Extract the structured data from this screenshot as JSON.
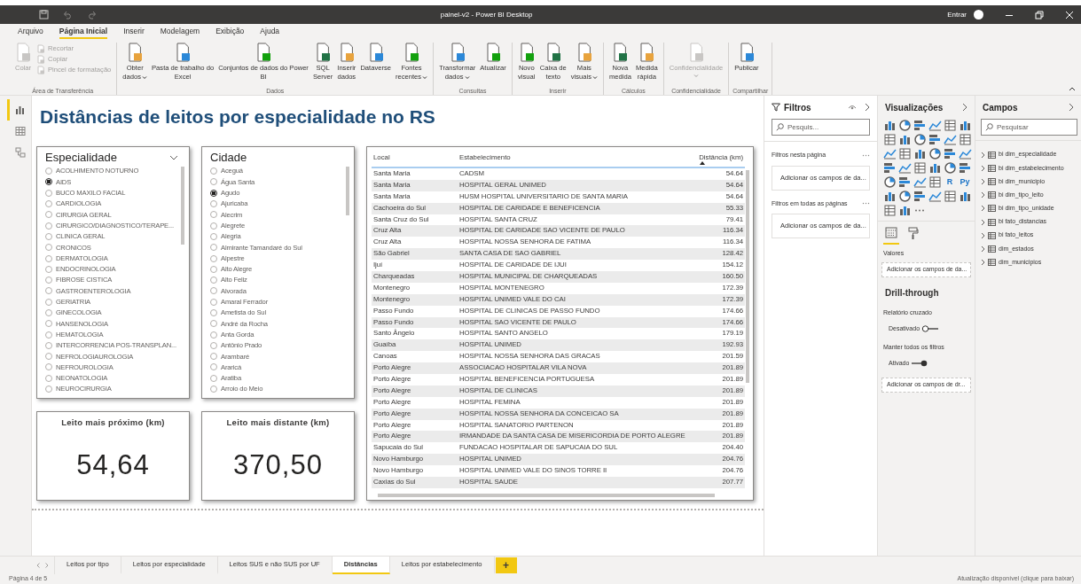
{
  "window": {
    "title": "painel-v2 - Power BI Desktop",
    "sign_in": "Entrar"
  },
  "ribbon": {
    "tabs": [
      {
        "label": "Arquivo",
        "selected": false
      },
      {
        "label": "Página Inicial",
        "selected": true
      },
      {
        "label": "Inserir",
        "selected": false
      },
      {
        "label": "Modelagem",
        "selected": false
      },
      {
        "label": "Exibição",
        "selected": false
      },
      {
        "label": "Ajuda",
        "selected": false
      }
    ],
    "groups": [
      {
        "label": "Área de Transferência",
        "commands": [
          {
            "label": "Colar",
            "kind": "large",
            "disabled": true,
            "dropdown": false
          },
          {
            "label": "Recortar",
            "kind": "small",
            "disabled": true,
            "dropdown": false
          },
          {
            "label": "Copiar",
            "kind": "small",
            "disabled": true,
            "dropdown": false
          },
          {
            "label": "Pincel de formatação",
            "kind": "small",
            "disabled": true,
            "dropdown": false
          }
        ]
      },
      {
        "label": "Dados",
        "commands": [
          {
            "label": "Obter\ndados",
            "kind": "large",
            "disabled": false,
            "dropdown": true
          },
          {
            "label": "Pasta de trabalho do\nExcel",
            "kind": "large",
            "disabled": false,
            "dropdown": false
          },
          {
            "label": "Conjuntos de dados do Power\nBI",
            "kind": "large",
            "disabled": false,
            "dropdown": false
          },
          {
            "label": "SQL\nServer",
            "kind": "large",
            "disabled": false,
            "dropdown": false
          },
          {
            "label": "Inserir\ndados",
            "kind": "large",
            "disabled": false,
            "dropdown": false
          },
          {
            "label": "Dataverse",
            "kind": "large",
            "disabled": false,
            "dropdown": false
          },
          {
            "label": "Fontes\nrecentes",
            "kind": "large",
            "disabled": false,
            "dropdown": true
          }
        ]
      },
      {
        "label": "Consultas",
        "commands": [
          {
            "label": "Transformar\ndados",
            "kind": "large",
            "disabled": false,
            "dropdown": true
          },
          {
            "label": "Atualizar",
            "kind": "large",
            "disabled": false,
            "dropdown": false
          }
        ]
      },
      {
        "label": "Inserir",
        "commands": [
          {
            "label": "Novo\nvisual",
            "kind": "large",
            "disabled": false,
            "dropdown": false
          },
          {
            "label": "Caixa de\ntexto",
            "kind": "large",
            "disabled": false,
            "dropdown": false
          },
          {
            "label": "Mais\nvisuais",
            "kind": "large",
            "disabled": false,
            "dropdown": true
          }
        ]
      },
      {
        "label": "Cálculos",
        "commands": [
          {
            "label": "Nova\nmedida",
            "kind": "large",
            "disabled": false,
            "dropdown": false
          },
          {
            "label": "Medida\nrápida",
            "kind": "large",
            "disabled": false,
            "dropdown": false
          }
        ]
      },
      {
        "label": "Confidencialidade",
        "commands": [
          {
            "label": "Confidencialidade",
            "kind": "large",
            "disabled": true,
            "dropdown": true
          }
        ]
      },
      {
        "label": "Compartilhar",
        "commands": [
          {
            "label": "Publicar",
            "kind": "large",
            "disabled": false,
            "dropdown": false
          }
        ]
      }
    ]
  },
  "view_rail": {
    "views": [
      {
        "kind": "report",
        "selected": true
      },
      {
        "kind": "data",
        "selected": false
      },
      {
        "kind": "model",
        "selected": false
      }
    ]
  },
  "report": {
    "title": "Distâncias de leitos por especialidade no RS",
    "slicers": [
      {
        "title": "Especialidade",
        "dropdown": true,
        "items": [
          {
            "label": "ACOLHIMENTO NOTURNO",
            "selected": false
          },
          {
            "label": "AIDS",
            "selected": true
          },
          {
            "label": "BUCO MAXILO FACIAL",
            "selected": false
          },
          {
            "label": "CARDIOLOGIA",
            "selected": false
          },
          {
            "label": "CIRURGIA GERAL",
            "selected": false
          },
          {
            "label": "CIRURGICO/DIAGNOSTICO/TERAPE...",
            "selected": false
          },
          {
            "label": "CLINICA GERAL",
            "selected": false
          },
          {
            "label": "CRONICOS",
            "selected": false
          },
          {
            "label": "DERMATOLOGIA",
            "selected": false
          },
          {
            "label": "ENDOCRINOLOGIA",
            "selected": false
          },
          {
            "label": "FIBROSE CISTICA",
            "selected": false
          },
          {
            "label": "GASTROENTEROLOGIA",
            "selected": false
          },
          {
            "label": "GERIATRIA",
            "selected": false
          },
          {
            "label": "GINECOLOGIA",
            "selected": false
          },
          {
            "label": "HANSENOLOGIA",
            "selected": false
          },
          {
            "label": "HEMATOLOGIA",
            "selected": false
          },
          {
            "label": "INTERCORRENCIA POS-TRANSPLAN...",
            "selected": false
          },
          {
            "label": "NEFROLOGIAUROLOGIA",
            "selected": false
          },
          {
            "label": "NEFROUROLOGIA",
            "selected": false
          },
          {
            "label": "NEONATOLOGIA",
            "selected": false
          },
          {
            "label": "NEUROCIRURGIA",
            "selected": false
          }
        ]
      },
      {
        "title": "Cidade",
        "dropdown": false,
        "items": [
          {
            "label": "Aceguá",
            "selected": false
          },
          {
            "label": "Água Santa",
            "selected": false
          },
          {
            "label": "Agudo",
            "selected": true
          },
          {
            "label": "Ajuricaba",
            "selected": false
          },
          {
            "label": "Alecrim",
            "selected": false
          },
          {
            "label": "Alegrete",
            "selected": false
          },
          {
            "label": "Alegria",
            "selected": false
          },
          {
            "label": "Almirante Tamandaré do Sul",
            "selected": false
          },
          {
            "label": "Alpestre",
            "selected": false
          },
          {
            "label": "Alto Alegre",
            "selected": false
          },
          {
            "label": "Alto Feliz",
            "selected": false
          },
          {
            "label": "Alvorada",
            "selected": false
          },
          {
            "label": "Amaral Ferrador",
            "selected": false
          },
          {
            "label": "Ametista do Sul",
            "selected": false
          },
          {
            "label": "André da Rocha",
            "selected": false
          },
          {
            "label": "Anta Gorda",
            "selected": false
          },
          {
            "label": "Antônio Prado",
            "selected": false
          },
          {
            "label": "Arambaré",
            "selected": false
          },
          {
            "label": "Araricá",
            "selected": false
          },
          {
            "label": "Aratiba",
            "selected": false
          },
          {
            "label": "Arroio do Meio",
            "selected": false
          }
        ]
      }
    ],
    "cards": [
      {
        "title": "Leito mais próximo (km)",
        "value": "54,64"
      },
      {
        "title": "Leito mais distante (km)",
        "value": "370,50"
      }
    ],
    "table": {
      "columns": [
        {
          "label": "Local",
          "sorted": false
        },
        {
          "label": "Estabelecimento",
          "sorted": false
        },
        {
          "label": "Distância (km)",
          "sorted": true
        }
      ],
      "rows": [
        [
          "Santa Maria",
          "CADSM",
          "54.64"
        ],
        [
          "Santa Maria",
          "HOSPITAL GERAL UNIMED",
          "54.64"
        ],
        [
          "Santa Maria",
          "HUSM HOSPITAL UNIVERSITARIO DE SANTA MARIA",
          "54.64"
        ],
        [
          "Cachoeira do Sul",
          "HOSPITAL DE CARIDADE E BENEFICENCIA",
          "55.33"
        ],
        [
          "Santa Cruz do Sul",
          "HOSPITAL SANTA CRUZ",
          "79.41"
        ],
        [
          "Cruz Alta",
          "HOSPITAL DE CARIDADE SAO VICENTE DE PAULO",
          "116.34"
        ],
        [
          "Cruz Alta",
          "HOSPITAL NOSSA SENHORA DE FATIMA",
          "116.34"
        ],
        [
          "São Gabriel",
          "SANTA CASA DE SAO GABRIEL",
          "128.42"
        ],
        [
          "Ijuí",
          "HOSPITAL DE CARIDADE DE IJUI",
          "154.12"
        ],
        [
          "Charqueadas",
          "HOSPITAL MUNICIPAL DE CHARQUEADAS",
          "160.50"
        ],
        [
          "Montenegro",
          "HOSPITAL MONTENEGRO",
          "172.39"
        ],
        [
          "Montenegro",
          "HOSPITAL UNIMED VALE DO CAI",
          "172.39"
        ],
        [
          "Passo Fundo",
          "HOSPITAL DE CLINICAS DE PASSO FUNDO",
          "174.66"
        ],
        [
          "Passo Fundo",
          "HOSPITAL SAO VICENTE DE PAULO",
          "174.66"
        ],
        [
          "Santo Ângelo",
          "HOSPITAL SANTO ANGELO",
          "179.19"
        ],
        [
          "Guaíba",
          "HOSPITAL UNIMED",
          "192.93"
        ],
        [
          "Canoas",
          "HOSPITAL NOSSA SENHORA DAS GRACAS",
          "201.59"
        ],
        [
          "Porto Alegre",
          "ASSOCIACAO HOSPITALAR VILA NOVA",
          "201.89"
        ],
        [
          "Porto Alegre",
          "HOSPITAL BENEFICENCIA PORTUGUESA",
          "201.89"
        ],
        [
          "Porto Alegre",
          "HOSPITAL DE CLINICAS",
          "201.89"
        ],
        [
          "Porto Alegre",
          "HOSPITAL FEMINA",
          "201.89"
        ],
        [
          "Porto Alegre",
          "HOSPITAL NOSSA SENHORA DA CONCEICAO SA",
          "201.89"
        ],
        [
          "Porto Alegre",
          "HOSPITAL SANATORIO PARTENON",
          "201.89"
        ],
        [
          "Porto Alegre",
          "IRMANDADE DA SANTA CASA DE MISERICORDIA DE PORTO ALEGRE",
          "201.89"
        ],
        [
          "Sapucaia do Sul",
          "FUNDACAO HOSPITALAR DE SAPUCAIA DO SUL",
          "204.40"
        ],
        [
          "Novo Hamburgo",
          "HOSPITAL UNIMED",
          "204.76"
        ],
        [
          "Novo Hamburgo",
          "HOSPITAL UNIMED VALE DO SINOS TORRE II",
          "204.76"
        ],
        [
          "Caxias do Sul",
          "HOSPITAL SAUDE",
          "207.77"
        ]
      ]
    }
  },
  "filters": {
    "title": "Filtros",
    "search_placeholder": "Pesquis...",
    "sections": [
      {
        "label": "Filtros nesta página",
        "drop_hint": "Adicionar os campos de da..."
      },
      {
        "label": "Filtros em todas as páginas",
        "drop_hint": "Adicionar os campos de da..."
      }
    ]
  },
  "visualizations": {
    "title": "Visualizações",
    "gallery": [
      {
        "kind": "icon"
      },
      {
        "kind": "icon"
      },
      {
        "kind": "icon"
      },
      {
        "kind": "icon"
      },
      {
        "kind": "icon"
      },
      {
        "kind": "icon"
      },
      {
        "kind": "icon"
      },
      {
        "kind": "icon"
      },
      {
        "kind": "icon"
      },
      {
        "kind": "icon"
      },
      {
        "kind": "icon"
      },
      {
        "kind": "icon"
      },
      {
        "kind": "icon"
      },
      {
        "kind": "icon"
      },
      {
        "kind": "icon"
      },
      {
        "kind": "icon"
      },
      {
        "kind": "icon"
      },
      {
        "kind": "icon"
      },
      {
        "kind": "icon"
      },
      {
        "kind": "icon"
      },
      {
        "kind": "icon"
      },
      {
        "kind": "icon"
      },
      {
        "kind": "icon"
      },
      {
        "kind": "icon"
      },
      {
        "kind": "icon"
      },
      {
        "kind": "icon"
      },
      {
        "kind": "icon"
      },
      {
        "kind": "icon"
      },
      {
        "kind": "text",
        "label": "R"
      },
      {
        "kind": "text",
        "label": "Py"
      },
      {
        "kind": "icon"
      },
      {
        "kind": "icon"
      },
      {
        "kind": "icon"
      },
      {
        "kind": "icon"
      },
      {
        "kind": "icon"
      },
      {
        "kind": "icon"
      },
      {
        "kind": "icon"
      },
      {
        "kind": "icon"
      },
      {
        "kind": "more"
      }
    ],
    "build_tabs": [
      {
        "kind": "fields",
        "selected": true
      },
      {
        "kind": "format",
        "selected": false
      }
    ],
    "values_label": "Valores",
    "values_hint": "Adicionar os campos de da...",
    "drill_through": {
      "title": "Drill-through",
      "settings": [
        {
          "label": "Relatório cruzado",
          "state_label": "Desativado",
          "on": false
        },
        {
          "label": "Manter todos os filtros",
          "state_label": "Ativado",
          "on": true
        }
      ],
      "drop_hint": "Adicionar os campos de dr..."
    }
  },
  "fields": {
    "title": "Campos",
    "search_placeholder": "Pesquisar",
    "tables": [
      {
        "label": "bi dim_especialidade"
      },
      {
        "label": "bi dim_estabelecimento"
      },
      {
        "label": "bi dim_municipio"
      },
      {
        "label": "bi dim_tipo_leito"
      },
      {
        "label": "bi dim_tipo_unidade"
      },
      {
        "label": "bi fato_distancias"
      },
      {
        "label": "bi fato_leitos"
      },
      {
        "label": "dim_estados"
      },
      {
        "label": "dim_municipios"
      }
    ]
  },
  "page_tabs": [
    {
      "label": "Leitos por tipo",
      "selected": false
    },
    {
      "label": "Leitos por especialidade",
      "selected": false
    },
    {
      "label": "Leitos SUS e não SUS por UF",
      "selected": false
    },
    {
      "label": "Distâncias",
      "selected": true
    },
    {
      "label": "Leitos por estabelecimento",
      "selected": false
    }
  ],
  "add_page": "+",
  "status_bar": {
    "page": "Página 4 de 5",
    "update": "Atualização disponível (clique para baixar)"
  }
}
